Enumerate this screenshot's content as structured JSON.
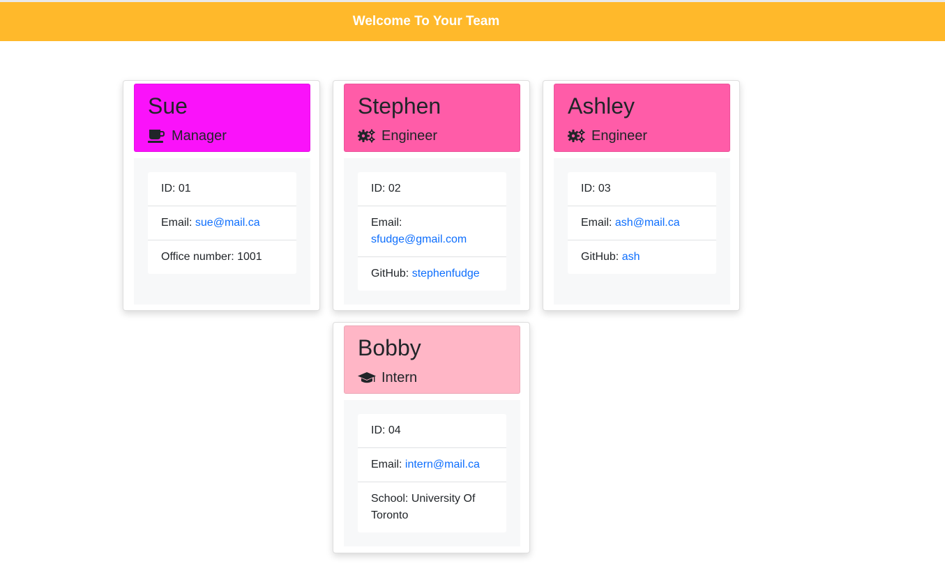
{
  "header": {
    "title": "Welcome To Your Team"
  },
  "colors": {
    "banner": "#ffb92b",
    "manager": "#fa12fa",
    "engineer": "#ff5ca8",
    "intern": "#ffb6c6",
    "link": "#0d6efd"
  },
  "employees": [
    {
      "name": "Sue",
      "role": "Manager",
      "role_icon": "coffee-mug-icon",
      "id_label": "ID: ",
      "id": "01",
      "email_label": "Email: ",
      "email": "sue@mail.ca",
      "extra_label": "Office number: ",
      "extra": "1001"
    },
    {
      "name": "Stephen",
      "role": "Engineer",
      "role_icon": "gears-icon",
      "id_label": "ID: ",
      "id": "02",
      "email_label": "Email: ",
      "email": "sfudge@gmail.com",
      "extra_label": "GitHub: ",
      "extra": "stephenfudge"
    },
    {
      "name": "Ashley",
      "role": "Engineer",
      "role_icon": "gears-icon",
      "id_label": "ID: ",
      "id": "03",
      "email_label": "Email: ",
      "email": "ash@mail.ca",
      "extra_label": "GitHub: ",
      "extra": "ash"
    },
    {
      "name": "Bobby",
      "role": "Intern",
      "role_icon": "graduation-cap-icon",
      "id_label": "ID: ",
      "id": "04",
      "email_label": "Email: ",
      "email": "intern@mail.ca",
      "extra_label": "School: ",
      "extra": "University Of Toronto"
    }
  ]
}
